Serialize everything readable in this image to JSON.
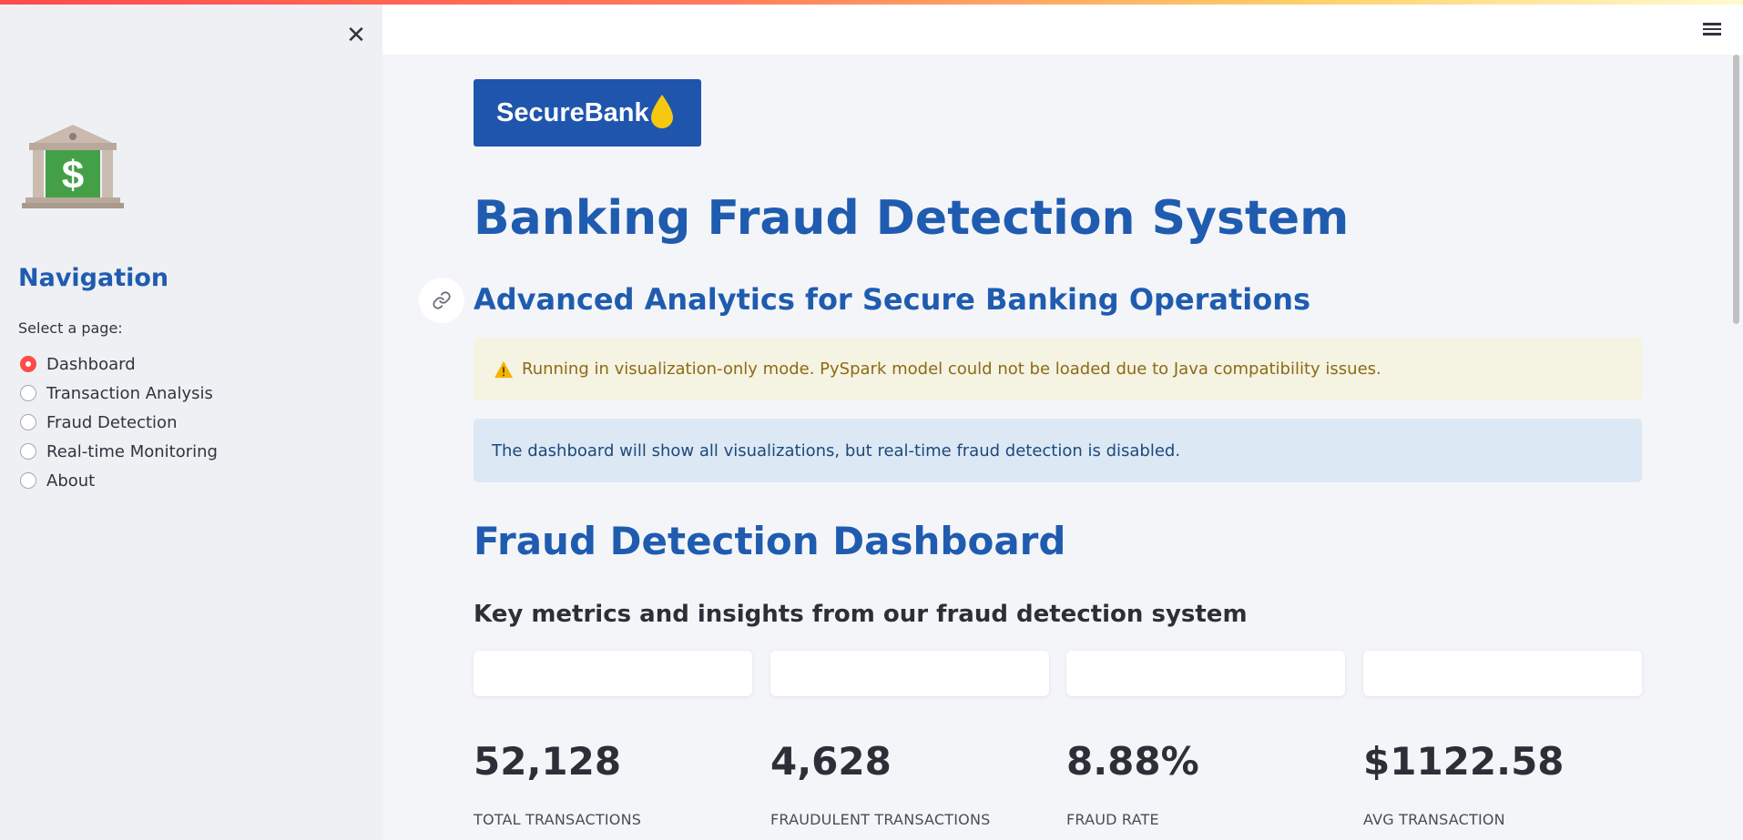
{
  "sidebar": {
    "nav_title": "Navigation",
    "select_label": "Select a page:",
    "items": [
      {
        "label": "Dashboard",
        "selected": true
      },
      {
        "label": "Transaction Analysis",
        "selected": false
      },
      {
        "label": "Fraud Detection",
        "selected": false
      },
      {
        "label": "Real-time Monitoring",
        "selected": false
      },
      {
        "label": "About",
        "selected": false
      }
    ],
    "icons": {
      "close": "close-icon",
      "logo": "bank-building-icon"
    }
  },
  "header": {
    "menu_icon": "hamburger-menu-icon"
  },
  "brand": {
    "logo_text": "SecureBank",
    "logo_icon": "droplet-icon",
    "logo_bg": "#1f55ad",
    "drop_color": "#f6c90e"
  },
  "main": {
    "title": "Banking Fraud Detection System",
    "subtitle": "Advanced Analytics for Secure Banking Operations",
    "warning": "Running in visualization-only mode. PySpark model could not be loaded due to Java compatibility issues.",
    "info": "The dashboard will show all visualizations, but real-time fraud detection is disabled.",
    "section_title": "Fraud Detection Dashboard",
    "section_subtitle": "Key metrics and insights from our fraud detection system",
    "metrics": [
      {
        "value": "52,128",
        "label": "TOTAL TRANSACTIONS"
      },
      {
        "value": "4,628",
        "label": "FRAUDULENT TRANSACTIONS"
      },
      {
        "value": "8.88%",
        "label": "FRAUD RATE"
      },
      {
        "value": "$1122.58",
        "label": "AVG TRANSACTION"
      }
    ]
  },
  "colors": {
    "accent": "#ff4b4b",
    "heading_blue": "#1f5cb0",
    "warning_bg": "#f5f3e2",
    "info_bg": "#dde8f5"
  }
}
